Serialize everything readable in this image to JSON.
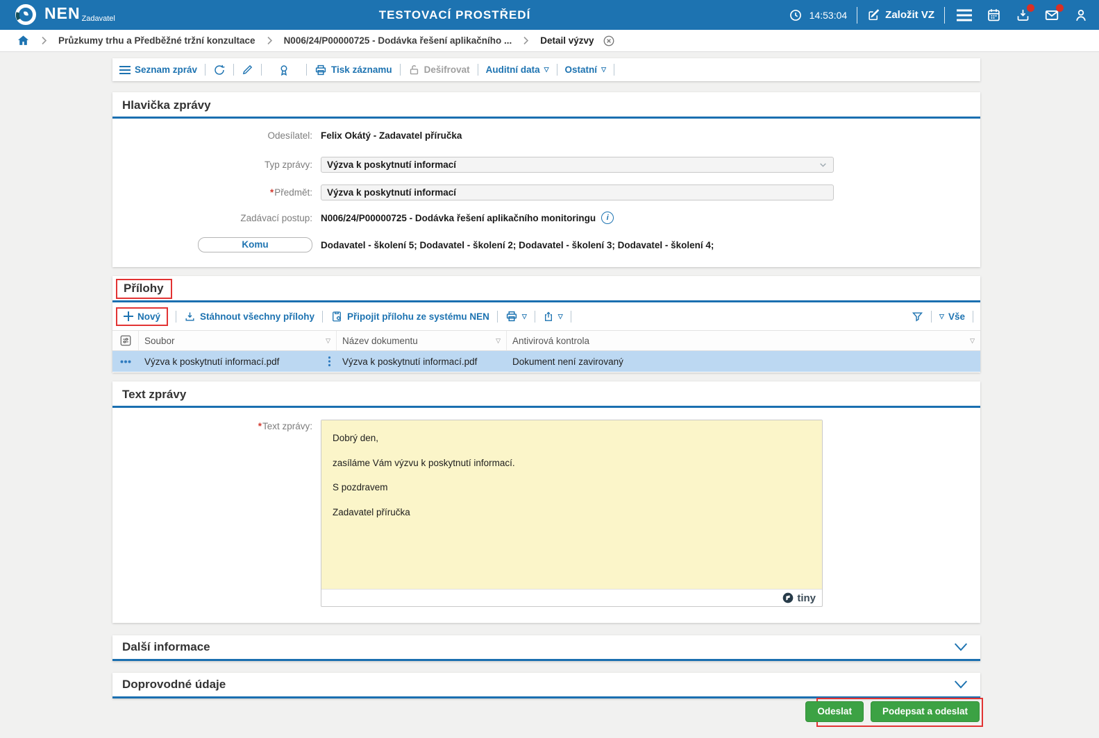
{
  "header": {
    "brand": "NEN",
    "brand_sub": "Zadavatel",
    "env_title": "TESTOVACÍ PROSTŘEDÍ",
    "time": "14:53:04",
    "create_vz_label": "Založit VZ"
  },
  "breadcrumb": {
    "items": [
      "Průzkumy trhu a Předběžné tržní konzultace",
      "N006/24/P00000725 - Dodávka řešení aplikačního ...",
      "Detail výzvy"
    ]
  },
  "toolbar": {
    "seznam_zprav": "Seznam zpráv",
    "tisk_zaznamu": "Tisk záznamu",
    "desifrovat": "Dešifrovat",
    "auditni_data": "Auditní data",
    "ostatni": "Ostatní"
  },
  "ui": {
    "required_marker": "*"
  },
  "hlavicka": {
    "title": "Hlavička zprávy",
    "odesilatel_label": "Odesílatel:",
    "odesilatel_value": "Felix Okátý - Zadavatel příručka",
    "typ_zpravy_label": "Typ zprávy:",
    "typ_zpravy_value": "Výzva k poskytnutí informací",
    "predmet_label": "Předmět:",
    "predmet_value": "Výzva k poskytnutí informací",
    "zadavaci_postup_label": "Zadávací postup:",
    "zadavaci_postup_value": "N006/24/P00000725 - Dodávka řešení aplikačního monitoringu",
    "komu_label": "Komu",
    "komu_value": "Dodavatel - školení 5; Dodavatel - školení 2; Dodavatel - školení 3; Dodavatel - školení 4;"
  },
  "prilohy": {
    "title": "Přílohy",
    "novy_label": "Nový",
    "stahnout_label": "Stáhnout všechny přílohy",
    "pripojit_label": "Připojit přílohu ze systému NEN",
    "vse_label": "Vše",
    "columns": [
      "Soubor",
      "Název dokumentu",
      "Antivirová kontrola"
    ],
    "row": {
      "soubor": "Výzva k poskytnutí informací.pdf",
      "nazev": "Výzva k poskytnutí informací.pdf",
      "antivir": "Dokument není zavirovaný"
    }
  },
  "text_zpravy": {
    "title": "Text zprávy",
    "label": "Text zprávy:",
    "lines": [
      "Dobrý den,",
      "zasíláme Vám výzvu k poskytnutí informací.",
      "S pozdravem",
      "Zadavatel příručka"
    ],
    "editor_brand": "tiny"
  },
  "sections": {
    "dalsi_informace": "Další informace",
    "doprovodne_udaje": "Doprovodné údaje"
  },
  "footer": {
    "odeslat_label": "Odeslat",
    "podepsat_label": "Podepsat a odeslat"
  },
  "colors": {
    "header_blue": "#1d73b1",
    "rule_blue": "#1a6fb0",
    "green_button": "#3ca244",
    "annotation_red": "#e23333",
    "row_highlight": "#bcd8f2",
    "editor_yellow": "#fbf5c9",
    "badge_red": "#d93025"
  }
}
